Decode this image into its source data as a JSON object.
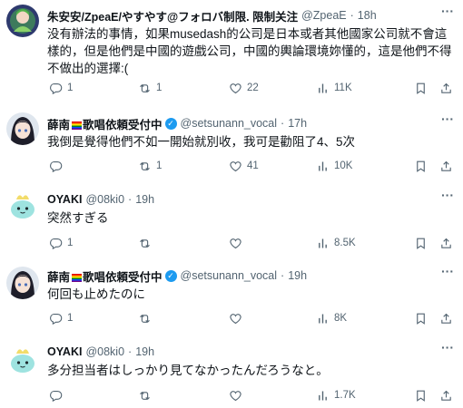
{
  "tweets": [
    {
      "name": "朱安安/ZpeaE/やすやす@フォロバ制限. 限制关注",
      "handle": "@ZpeaE",
      "time": "18h",
      "text": "没有辦法的事情，如果musedash的公司是日本或者其他國家公司就不會這樣的，但是他們是中國的遊戲公司，中國的輿論環境妳懂的，這是他們不得不做出的選擇:(",
      "replies": "1",
      "reposts": "1",
      "likes": "22",
      "views": "11K"
    },
    {
      "name": "薛南",
      "name_suffix": "歌唱依頼受付中",
      "handle": "@setsunann_vocal",
      "time": "17h",
      "text": "我倒是覺得他們不如一開始就別收，我可是勸阻了4、5次",
      "replies": "",
      "reposts": "1",
      "likes": "41",
      "views": "10K"
    },
    {
      "name": "OYAKI",
      "handle": "@08ki0",
      "time": "19h",
      "text": "突然すぎる",
      "replies": "1",
      "reposts": "",
      "likes": "",
      "views": "8.5K"
    },
    {
      "name": "薛南",
      "name_suffix": "歌唱依頼受付中",
      "handle": "@setsunann_vocal",
      "time": "19h",
      "text": "何回も止めたのに",
      "replies": "1",
      "reposts": "",
      "likes": "",
      "views": "8K"
    },
    {
      "name": "OYAKI",
      "handle": "@08ki0",
      "time": "19h",
      "text": "多分担当者はしっかり見てなかったんだろうなと。",
      "replies": "",
      "reposts": "",
      "likes": "",
      "views": "1.7K"
    }
  ],
  "separator": "·",
  "more_label": "···",
  "icons": {
    "reply": "reply-icon",
    "repost": "repost-icon",
    "like": "like-icon",
    "views": "views-icon",
    "bookmark": "bookmark-icon",
    "share": "share-icon"
  },
  "colors": {
    "text": "#0f1419",
    "secondary": "#536471",
    "verified": "#1d9bf0"
  }
}
